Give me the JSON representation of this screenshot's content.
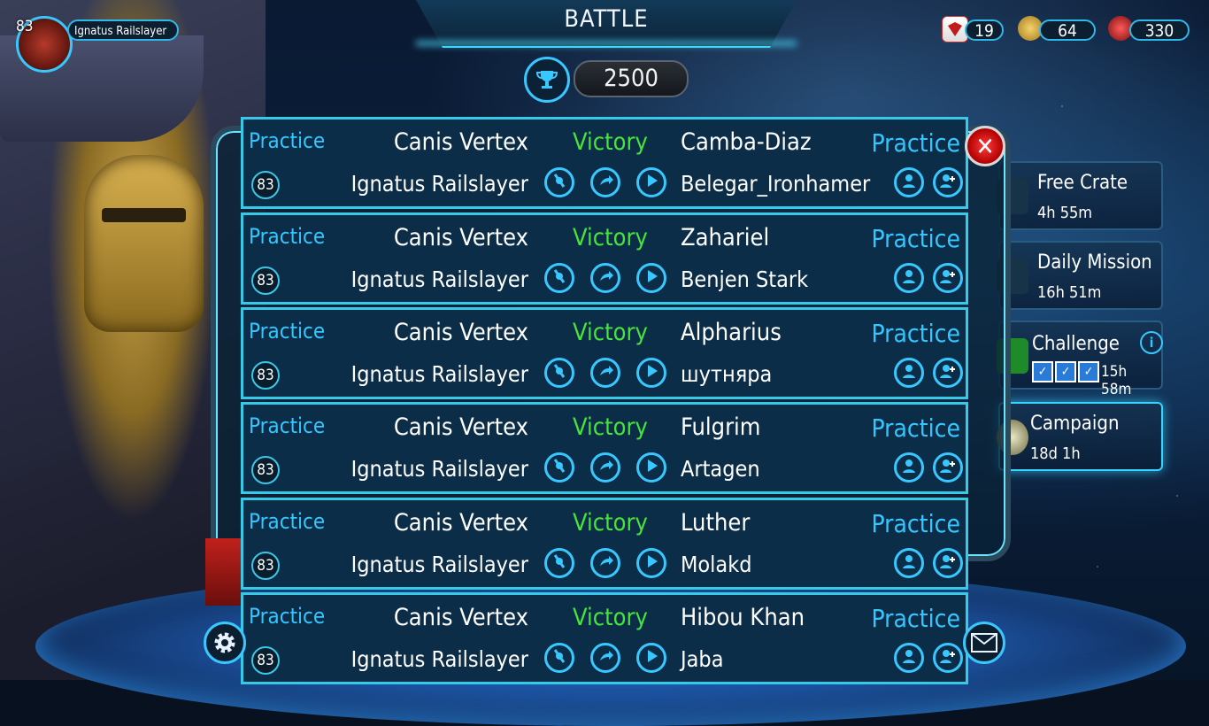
{
  "header": {
    "title": "BATTLE",
    "trophy_value": "2500"
  },
  "player": {
    "level": "83",
    "name": "Ignatus Railslayer"
  },
  "currencies": [
    {
      "icon": "card-icon",
      "value": "19"
    },
    {
      "icon": "gold-icon",
      "value": "64"
    },
    {
      "icon": "gem-icon",
      "value": "330"
    }
  ],
  "side_menu": [
    {
      "label": "Free Crate",
      "sub": "4h 55m"
    },
    {
      "label": "Daily Mission",
      "sub": "16h 51m"
    },
    {
      "label": "Challenge",
      "sub": "15h 58m"
    },
    {
      "label": "Campaign",
      "sub": "18d 1h"
    }
  ],
  "battles": [
    {
      "left_mode": "Practice",
      "left_legion": "Canis Vertex",
      "left_player": "Ignatus Railslayer",
      "level": "83",
      "result": "Victory",
      "right_legion": "Camba-Diaz",
      "right_player": "Belegar_Ironhamer",
      "right_mode": "Practice"
    },
    {
      "left_mode": "Practice",
      "left_legion": "Canis Vertex",
      "left_player": "Ignatus Railslayer",
      "level": "83",
      "result": "Victory",
      "right_legion": "Zahariel",
      "right_player": "Benjen Stark",
      "right_mode": "Practice"
    },
    {
      "left_mode": "Practice",
      "left_legion": "Canis Vertex",
      "left_player": "Ignatus Railslayer",
      "level": "83",
      "result": "Victory",
      "right_legion": "Alpharius",
      "right_player": "шутняра",
      "right_mode": "Practice"
    },
    {
      "left_mode": "Practice",
      "left_legion": "Canis Vertex",
      "left_player": "Ignatus Railslayer",
      "level": "83",
      "result": "Victory",
      "right_legion": "Fulgrim",
      "right_player": "Artagen",
      "right_mode": "Practice"
    },
    {
      "left_mode": "Practice",
      "left_legion": "Canis Vertex",
      "left_player": "Ignatus Railslayer",
      "level": "83",
      "result": "Victory",
      "right_legion": "Luther",
      "right_player": "Molakd",
      "right_mode": "Practice"
    },
    {
      "left_mode": "Practice",
      "left_legion": "Canis Vertex",
      "left_player": "Ignatus Railslayer",
      "level": "83",
      "result": "Victory",
      "right_legion": "Hibou Khan",
      "right_player": "Jaba",
      "right_mode": "Practice"
    }
  ],
  "colors": {
    "accent": "#38c8ff",
    "victory": "#47e43c",
    "practice": "#35c6ff"
  }
}
